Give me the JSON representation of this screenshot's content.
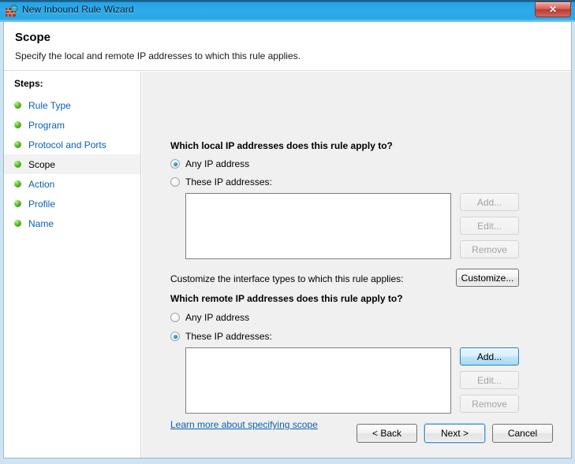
{
  "window": {
    "title": "New Inbound Rule Wizard",
    "icon": "firewall-icon",
    "close_label": "✕"
  },
  "header": {
    "title": "Scope",
    "subtitle": "Specify the local and remote IP addresses to which this rule applies."
  },
  "sidebar": {
    "label": "Steps:",
    "items": [
      {
        "label": "Rule Type",
        "active": false
      },
      {
        "label": "Program",
        "active": false
      },
      {
        "label": "Protocol and Ports",
        "active": false
      },
      {
        "label": "Scope",
        "active": true
      },
      {
        "label": "Action",
        "active": false
      },
      {
        "label": "Profile",
        "active": false
      },
      {
        "label": "Name",
        "active": false
      }
    ]
  },
  "main": {
    "local": {
      "heading": "Which local IP addresses does this rule apply to?",
      "radio_any": "Any IP address",
      "radio_these": "These IP addresses:",
      "selected": "any",
      "list_values": [],
      "add_label": "Add...",
      "edit_label": "Edit...",
      "remove_label": "Remove",
      "add_state": "disabled",
      "edit_state": "disabled",
      "remove_state": "disabled"
    },
    "interface": {
      "label": "Customize the interface types to which this rule applies:",
      "customize_label": "Customize...",
      "customize_state": "normal"
    },
    "remote": {
      "heading": "Which remote IP addresses does this rule apply to?",
      "radio_any": "Any IP address",
      "radio_these": "These IP addresses:",
      "selected": "these",
      "list_values": [],
      "add_label": "Add...",
      "edit_label": "Edit...",
      "remove_label": "Remove",
      "add_state": "hot",
      "edit_state": "disabled",
      "remove_state": "disabled"
    },
    "learn_more_link": "Learn more about specifying scope"
  },
  "footer": {
    "back_label": "< Back",
    "next_label": "Next >",
    "cancel_label": "Cancel"
  },
  "colors": {
    "titlebar": "#29a8e8",
    "accent_link": "#0b5fb4",
    "pane_background": "#f0f0f0",
    "sidebar_background": "#ffffff",
    "step_bullet": "#5fc427",
    "hot_button": "#bee6fd",
    "close_button": "#c24a42"
  }
}
